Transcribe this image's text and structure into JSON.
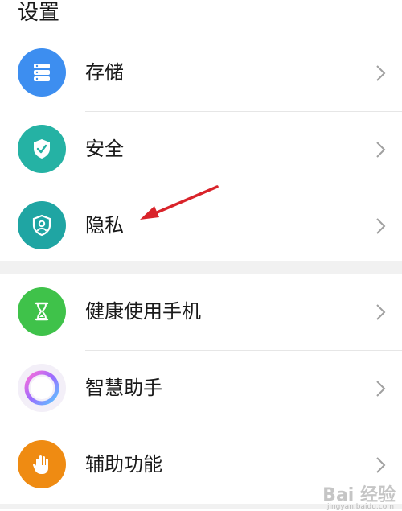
{
  "page": {
    "title": "设置"
  },
  "colors": {
    "storage": "#3d8ef0",
    "security": "#25b2a4",
    "privacy": "#1fa5a3",
    "digital_balance": "#3fc24a",
    "assistant_ring": "#a06cf0",
    "accessibility": "#ef8b12",
    "annotation_arrow": "#d9232a"
  },
  "groups": [
    {
      "items": [
        {
          "label": "存储",
          "icon": "storage-icon"
        },
        {
          "label": "安全",
          "icon": "shield-check-icon"
        },
        {
          "label": "隐私",
          "icon": "privacy-shield-icon"
        }
      ]
    },
    {
      "items": [
        {
          "label": "健康使用手机",
          "icon": "hourglass-icon"
        },
        {
          "label": "智慧助手",
          "icon": "assistant-ring-icon"
        },
        {
          "label": "辅助功能",
          "icon": "hand-icon"
        }
      ]
    }
  ],
  "watermark": {
    "text": "Bai 经验",
    "sub": "jingyan.baidu.com"
  }
}
